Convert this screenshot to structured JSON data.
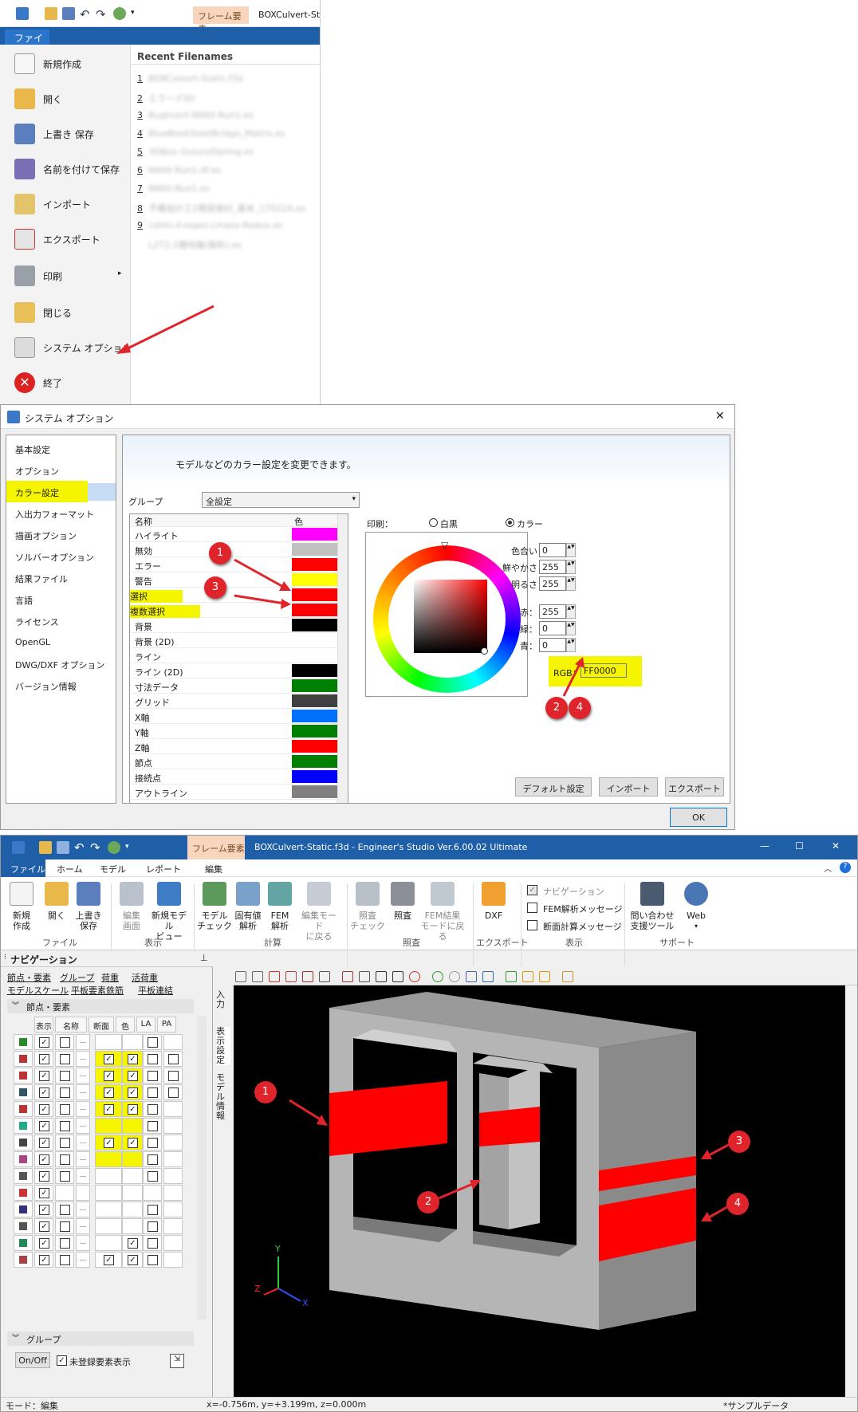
{
  "panel1": {
    "context_tab": "フレーム要素",
    "window_title": "BOXCulvert-St",
    "file_tab": "ファイル",
    "menu_items": [
      {
        "label": "新規作成",
        "icon": "new-file-icon"
      },
      {
        "label": "開く",
        "icon": "open-folder-icon"
      },
      {
        "label": "上書き 保存",
        "icon": "save-icon"
      },
      {
        "label": "名前を付けて保存",
        "icon": "save-as-icon"
      },
      {
        "label": "インポート",
        "icon": "import-icon"
      },
      {
        "label": "エクスポート",
        "icon": "export-icon"
      },
      {
        "label": "印刷",
        "icon": "printer-icon",
        "arrow": "▸"
      },
      {
        "label": "閉じる",
        "icon": "close-file-icon"
      },
      {
        "label": "システム オプション",
        "icon": "system-options-icon"
      },
      {
        "label": "終了",
        "icon": "exit-icon"
      }
    ],
    "recent_header": "Recent Filenames",
    "recent_files": [
      {
        "num": "1",
        "name": "BOXCulvert-Static.f3d"
      },
      {
        "num": "2",
        "name": "エラー.F3D"
      },
      {
        "num": "3",
        "name": "Bughvert-N660-Run1.es"
      },
      {
        "num": "4",
        "name": "BlueBookSteelBridge_Matrix.es"
      },
      {
        "num": "5",
        "name": "3DBox-GroundSpring.es"
      },
      {
        "num": "6",
        "name": "N660-Run1-4f.es"
      },
      {
        "num": "7",
        "name": "N660-Run1.es"
      },
      {
        "num": "8",
        "name": "予備設計工2橋梁検討_基本_17022A.es"
      },
      {
        "num": "9",
        "name": "cohm-X-eigen-Lmass-Redux.es"
      },
      {
        "num": "",
        "name": "L2T2-2種地盤(解析).es"
      }
    ]
  },
  "panel2": {
    "title": "システム オプション",
    "close": "✕",
    "nav_items": [
      "基本設定",
      "オプション",
      "カラー設定",
      "入出力フォーマット",
      "描画オプション",
      "ソルバーオプション",
      "結果ファイル",
      "言語",
      "ライセンス",
      "OpenGL",
      "DWG/DXF オプション",
      "バージョン情報"
    ],
    "selected_nav": "カラー設定",
    "banner_text": "モデルなどのカラー設定を変更できます。",
    "group_label": "グループ",
    "group_value": "全設定",
    "col_name": "名称",
    "col_color": "色",
    "rows": [
      {
        "name": "ハイライト",
        "color": "#ff00ff"
      },
      {
        "name": "無効",
        "color": "#c0c0c0"
      },
      {
        "name": "エラー",
        "color": "#ff0000"
      },
      {
        "name": "警告",
        "color": "#ffff00"
      },
      {
        "name": "選択",
        "color": "#ff0000"
      },
      {
        "name": "複数選択",
        "color": "#ff0000"
      },
      {
        "name": "背景",
        "color": "#000000"
      },
      {
        "name": "背景 (2D)",
        "color": "#ffffff"
      },
      {
        "name": "ライン",
        "color": "#ffffff"
      },
      {
        "name": "ライン (2D)",
        "color": "#000000"
      },
      {
        "name": "寸法データ",
        "color": "#008000"
      },
      {
        "name": "グリッド",
        "color": "#404040"
      },
      {
        "name": "X軸",
        "color": "#0070ff"
      },
      {
        "name": "Y軸",
        "color": "#008000"
      },
      {
        "name": "Z軸",
        "color": "#ff0000"
      },
      {
        "name": "節点",
        "color": "#008000"
      },
      {
        "name": "接続点",
        "color": "#0000ff"
      },
      {
        "name": "アウトライン",
        "color": "#808080"
      }
    ],
    "print_label": "印刷：",
    "print_bw": "白黒",
    "print_color": "カラー",
    "hue_label": "色合い",
    "hue": "0",
    "sat_label": "鮮やかさ",
    "sat": "255",
    "lum_label": "明るさ",
    "lum": "255",
    "red_label": "赤：",
    "red": "255",
    "green_label": "緑：",
    "green": "0",
    "blue_label": "青：",
    "blue": "0",
    "rgb_label": "RGB：",
    "rgb": "FF0000",
    "btn_default": "デフォルト設定",
    "btn_import": "インポート",
    "btn_export": "エクスポート",
    "btn_ok": "OK",
    "badges": [
      "1",
      "3",
      "2",
      "4"
    ]
  },
  "panel3": {
    "context_tab": "フレーム要素",
    "title": "BOXCulvert-Static.f3d - Engineer's Studio Ver.6.00.02 Ultimate",
    "win_min": "—",
    "win_max": "☐",
    "win_close": "✕",
    "tabs": [
      "ファイル",
      "ホーム",
      "モデル",
      "レポート",
      "編集"
    ],
    "ribbon_buttons": [
      {
        "label": "新規\n作成",
        "icon": "new-file-icon"
      },
      {
        "label": "開く",
        "icon": "open-folder-icon"
      },
      {
        "label": "上書き\n保存",
        "icon": "save-icon"
      },
      {
        "label": "編集\n画面",
        "icon": "edit-screen-icon"
      },
      {
        "label": "新規モデル\nビュー",
        "icon": "new-model-view-icon"
      },
      {
        "label": "モデル\nチェック",
        "icon": "model-check-icon"
      },
      {
        "label": "固有値\n解析",
        "icon": "eigen-analysis-icon"
      },
      {
        "label": "FEM\n解析",
        "icon": "fem-analysis-icon"
      },
      {
        "label": "編集モード\nに戻る",
        "icon": "back-edit-icon"
      },
      {
        "label": "照査\nチェック",
        "icon": "verify-check-icon"
      },
      {
        "label": "照査",
        "icon": "verify-icon"
      },
      {
        "label": "FEM結果\nモードに戻る",
        "icon": "fem-result-icon"
      },
      {
        "label": "DXF",
        "icon": "dxf-export-icon"
      },
      {
        "label": "問い合わせ\n支援ツール",
        "icon": "support-tool-icon"
      },
      {
        "label": "Web",
        "icon": "info-icon"
      }
    ],
    "ribbon_groups": [
      "ファイル",
      "表示",
      "計算",
      "照査",
      "エクスポート",
      "表示",
      "サポート"
    ],
    "view_checks": [
      {
        "label": "ナビゲーション",
        "checked": "✓"
      },
      {
        "label": "FEM解析メッセージ",
        "checked": ""
      },
      {
        "label": "断面計算メッセージ",
        "checked": ""
      }
    ],
    "nav_title": "ナビゲーション",
    "nav_links": [
      "節点・要素",
      "グループ",
      "荷重",
      "活荷重",
      "モデルスケール",
      "平板要素鉄筋",
      "平板連結"
    ],
    "nav_section": "節点・要素",
    "nav_cols": [
      "表示",
      "名称",
      "断面",
      "色",
      "LA",
      "PA"
    ],
    "group_section": "グループ",
    "onoff": "On/Off",
    "unreg": "未登録要素表示",
    "vtabs": [
      "入力",
      "表示設定",
      "モデル情報"
    ],
    "status_mode": "モード：編集",
    "status_coord": "x=-0.756m, y=+3.199m, z=0.000m",
    "status_sample": "*サンプルデータ",
    "axis_x": "X",
    "axis_y": "Y",
    "axis_z": "Z",
    "badges": [
      "1",
      "2",
      "3",
      "4"
    ]
  }
}
